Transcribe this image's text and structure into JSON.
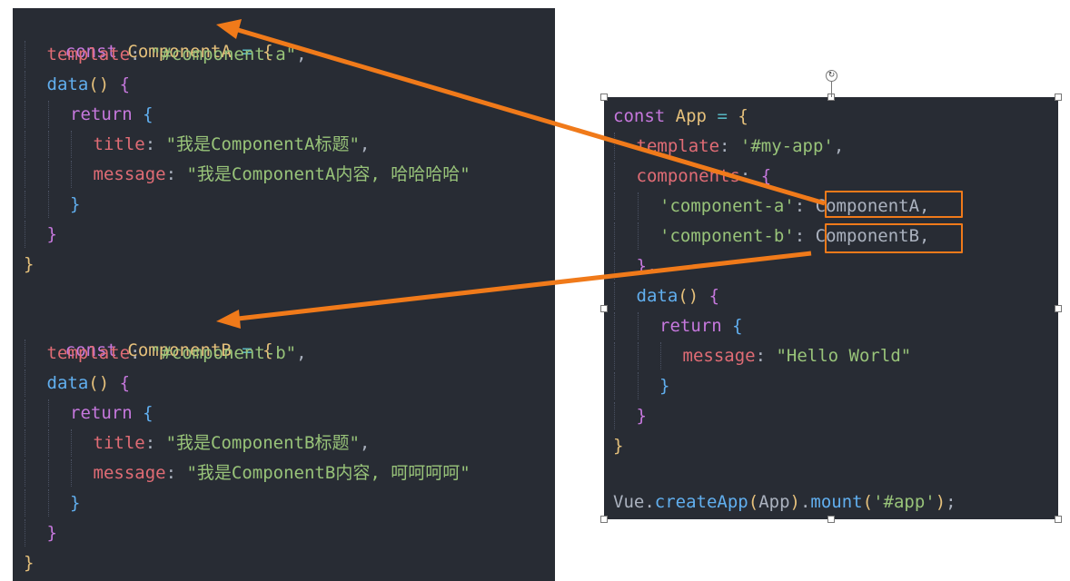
{
  "left_code": {
    "component_a": {
      "line1": {
        "kw": "const",
        "name": "ComponentA",
        "eq": "=",
        "brace": "{"
      },
      "line2": {
        "prop": "template",
        "colon": ":",
        "str": "\"#component-a\"",
        "comma": ","
      },
      "line3": {
        "fn": "data",
        "paren": "()",
        "brace": "{"
      },
      "line4": {
        "kw": "return",
        "brace": "{"
      },
      "line5": {
        "prop": "title",
        "colon": ":",
        "str": "\"我是ComponentA标题\"",
        "comma": ","
      },
      "line6": {
        "prop": "message",
        "colon": ":",
        "str": "\"我是ComponentA内容, 哈哈哈哈\""
      },
      "line7": {
        "brace": "}"
      },
      "line8": {
        "brace": "}"
      },
      "line9": {
        "brace": "}"
      }
    },
    "component_b": {
      "line1": {
        "kw": "const",
        "name": "ComponentB",
        "eq": "=",
        "brace": "{"
      },
      "line2": {
        "prop": "template",
        "colon": ":",
        "str": "\"#component-b\"",
        "comma": ","
      },
      "line3": {
        "fn": "data",
        "paren": "()",
        "brace": "{"
      },
      "line4": {
        "kw": "return",
        "brace": "{"
      },
      "line5": {
        "prop": "title",
        "colon": ":",
        "str": "\"我是ComponentB标题\"",
        "comma": ","
      },
      "line6": {
        "prop": "message",
        "colon": ":",
        "str": "\"我是ComponentB内容, 呵呵呵呵\""
      },
      "line7": {
        "brace": "}"
      },
      "line8": {
        "brace": "}"
      },
      "line9": {
        "brace": "}"
      }
    }
  },
  "right_code": {
    "line1": {
      "kw": "const",
      "name": "App",
      "eq": "=",
      "brace": "{"
    },
    "line2": {
      "prop": "template",
      "colon": ":",
      "str": "'#my-app'",
      "comma": ","
    },
    "line3": {
      "prop": "components",
      "colon": ":",
      "brace": "{"
    },
    "line4": {
      "str": "'component-a'",
      "colon": ":",
      "value": "ComponentA",
      "comma": ","
    },
    "line5": {
      "str": "'component-b'",
      "colon": ":",
      "value": "ComponentB",
      "comma": ","
    },
    "line6": {
      "brace": "},"
    },
    "line7": {
      "fn": "data",
      "paren": "()",
      "brace": "{"
    },
    "line8": {
      "kw": "return",
      "brace": "{"
    },
    "line9": {
      "prop": "message",
      "colon": ":",
      "str": "\"Hello World\""
    },
    "line10": {
      "brace": "}"
    },
    "line11": {
      "brace": "}"
    },
    "line12": {
      "brace": "}"
    },
    "line13": {
      "obj": "Vue",
      "dot1": ".",
      "fn1": "createApp",
      "p1": "(",
      "arg1": "App",
      "p2": ")",
      "dot2": ".",
      "fn2": "mount",
      "p3": "(",
      "arg2": "'#app'",
      "p4": ")",
      "semi": ";"
    }
  },
  "annotations": {
    "arrow_color": "#f07a1a",
    "rotate_glyph": "↻"
  },
  "theme": {
    "editor_bg": "#282c34",
    "keyword": "#c678dd",
    "declaration": "#e5c07b",
    "property": "#e06c75",
    "string": "#98c379",
    "function": "#61afef",
    "plain": "#abb2bf"
  }
}
